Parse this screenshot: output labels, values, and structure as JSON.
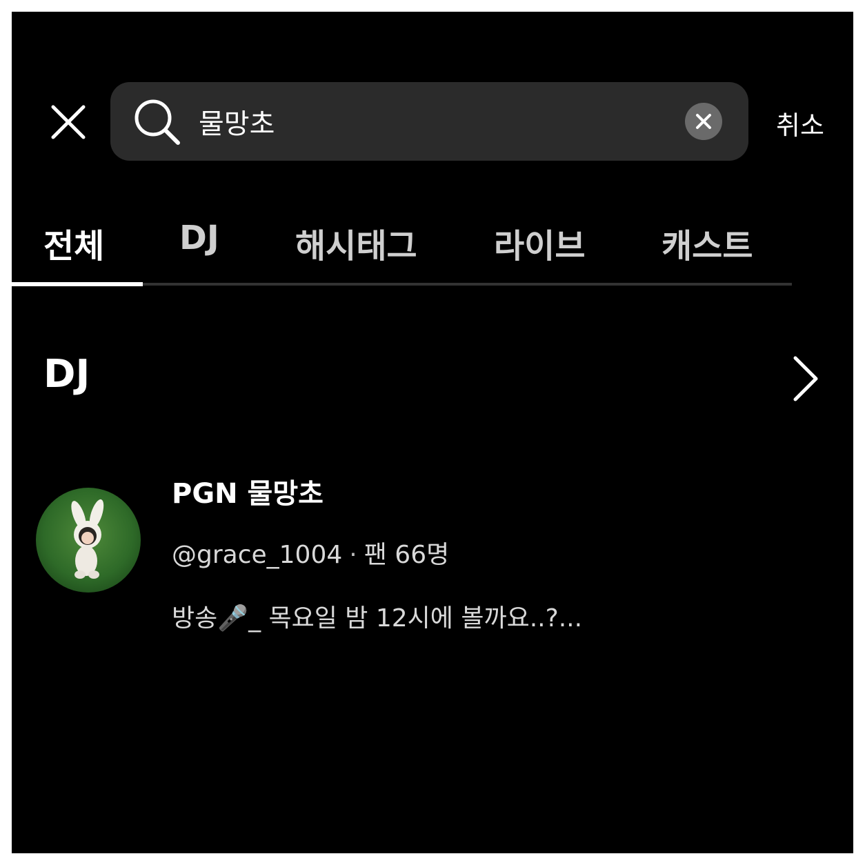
{
  "search": {
    "query": "물망초",
    "cancel_label": "취소"
  },
  "tabs": [
    {
      "label": "전체",
      "active": true
    },
    {
      "label": "DJ",
      "active": false
    },
    {
      "label": "해시태그",
      "active": false
    },
    {
      "label": "라이브",
      "active": false
    },
    {
      "label": "캐스트",
      "active": false
    }
  ],
  "section": {
    "title": "DJ"
  },
  "dj_result": {
    "name": "PGN 물망초",
    "handle": "@grace_1004",
    "separator": "·",
    "fans": "팬 66명",
    "description": "방송🎤_ 목요일 밤 12시에 볼까요..?..."
  },
  "icons": {
    "close": "close-icon",
    "search": "search-icon",
    "clear": "clear-icon",
    "more": "chevron-right-icon"
  },
  "colors": {
    "background": "#000000",
    "search_bg": "#2b2b2b",
    "clear_bg": "#6a6a6a",
    "text_primary": "#ffffff",
    "text_secondary": "#d9d9d9",
    "tab_track": "#333333"
  }
}
